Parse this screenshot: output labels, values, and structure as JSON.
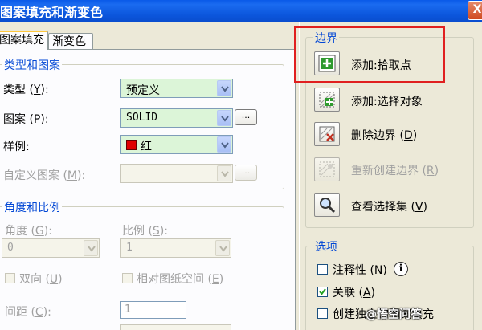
{
  "window": {
    "title": "图案填充和渐变色",
    "close_glyph": "X"
  },
  "tabs": [
    {
      "label": "图案填充"
    },
    {
      "label": "渐变色"
    }
  ],
  "type_pattern": {
    "group_label": "类型和图案",
    "type_label": "类型",
    "type_key": "Y",
    "type_value": "预定义",
    "pattern_label": "图案",
    "pattern_key": "P",
    "pattern_value": "SOLID",
    "swatch_label": "样例:",
    "swatch_value": "红",
    "swatch_color": "#e00000",
    "custom_label": "自定义图案",
    "custom_key": "M",
    "dots": "..."
  },
  "angle_scale": {
    "group_label": "角度和比例",
    "angle_label": "角度",
    "angle_key": "G",
    "angle_value": "0",
    "scale_label": "比例",
    "scale_key": "S",
    "scale_value": "1",
    "double_label": "双向",
    "double_key": "U",
    "relative_label": "相对图纸空间",
    "relative_key": "E",
    "spacing_label": "间距",
    "spacing_key": "C",
    "spacing_value": "1"
  },
  "boundary": {
    "group_label": "边界",
    "add_pick_label": "添加:拾取点",
    "add_select_label": "添加:选择对象",
    "remove_label": "删除边界",
    "remove_key": "D",
    "recreate_label": "重新创建边界",
    "recreate_key": "R",
    "view_label": "查看选择集",
    "view_key": "V"
  },
  "options": {
    "group_label": "选项",
    "annotative_label": "注释性",
    "annotative_key": "N",
    "info_glyph": "i",
    "associative_label": "关联",
    "associative_key": "A",
    "associative_checked": true,
    "independent_label": "创建独立的图案填充"
  },
  "watermark": "@悟空问答"
}
